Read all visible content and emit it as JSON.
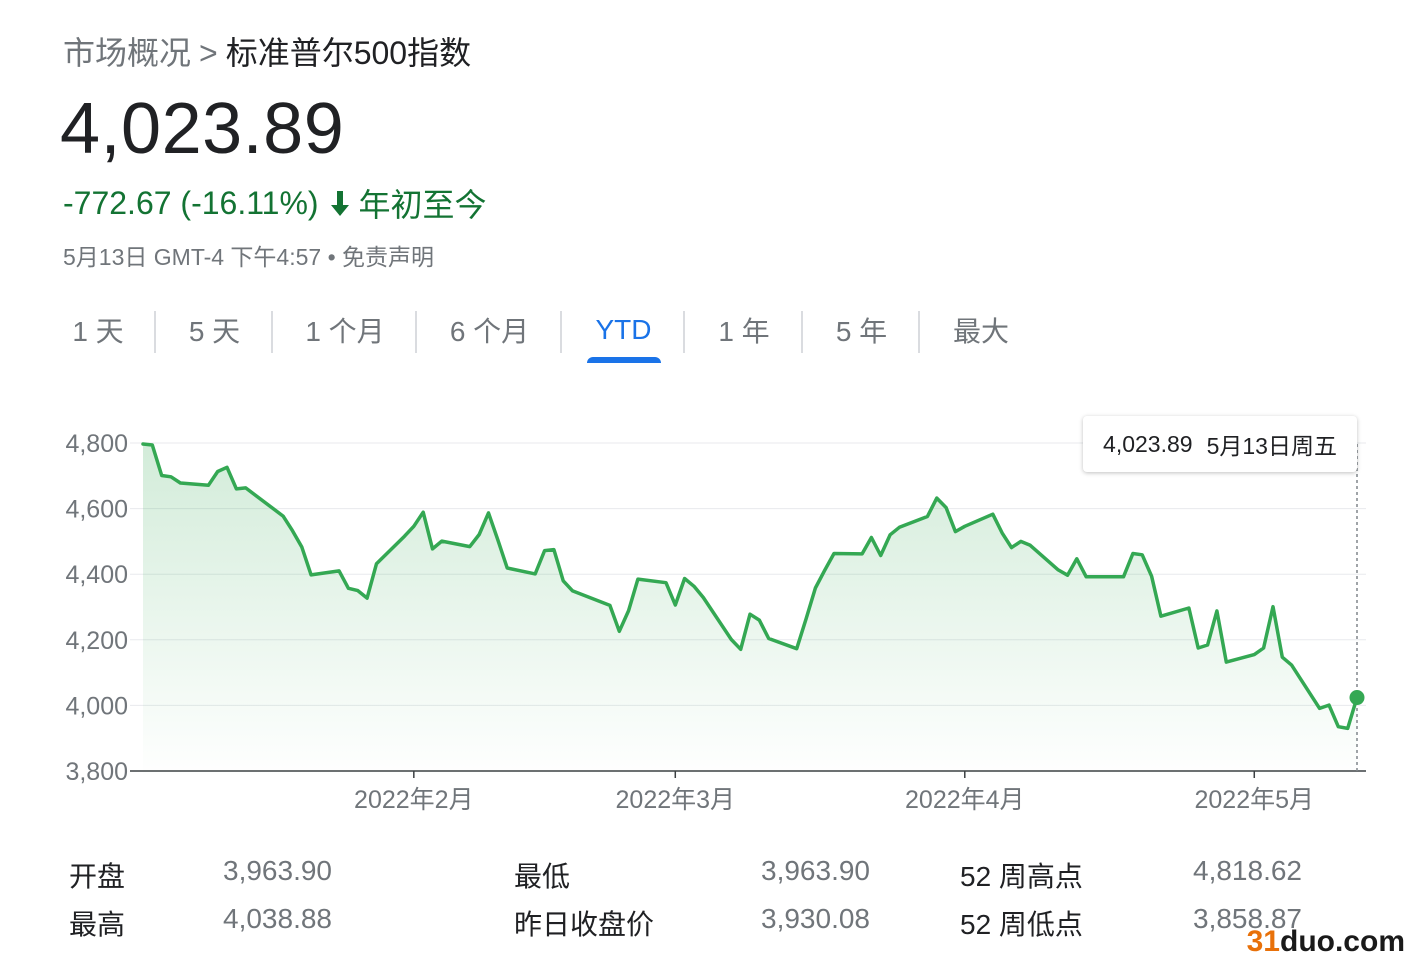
{
  "breadcrumb": {
    "parent": "市场概况",
    "separator": ">",
    "current": "标准普尔500指数"
  },
  "quote": {
    "price": "4,023.89",
    "change": "-772.67 (-16.11%)",
    "period": "年初至今",
    "timestamp": "5月13日 GMT-4 下午4:57",
    "bullet": "•",
    "disclaimer": "免责声明",
    "change_color": "#137333"
  },
  "tabs": [
    {
      "label": "1 天"
    },
    {
      "label": "5 天"
    },
    {
      "label": "1 个月"
    },
    {
      "label": "6 个月"
    },
    {
      "label": "YTD",
      "active": true
    },
    {
      "label": "1 年"
    },
    {
      "label": "5 年"
    },
    {
      "label": "最大"
    }
  ],
  "tooltip": {
    "value": "4,023.89",
    "date": "5月13日周五"
  },
  "chart_data": {
    "type": "area",
    "ylim": [
      3800,
      4800
    ],
    "yticks": [
      4800,
      4600,
      4400,
      4200,
      4000,
      3800
    ],
    "ytick_labels": [
      "4,800",
      "4,600",
      "4,400",
      "4,200",
      "4,000",
      "3,800"
    ],
    "xticks": [
      {
        "label": "2022年2月",
        "date": "2022-02-01"
      },
      {
        "label": "2022年3月",
        "date": "2022-03-01"
      },
      {
        "label": "2022年4月",
        "date": "2022-04-01"
      },
      {
        "label": "2022年5月",
        "date": "2022-05-02"
      }
    ],
    "grid": true,
    "line_color": "#34a853",
    "series": [
      {
        "points": [
          [
            "2022-01-03",
            4797
          ],
          [
            "2022-01-04",
            4794
          ],
          [
            "2022-01-05",
            4701
          ],
          [
            "2022-01-06",
            4697
          ],
          [
            "2022-01-07",
            4678
          ],
          [
            "2022-01-10",
            4671
          ],
          [
            "2022-01-11",
            4713
          ],
          [
            "2022-01-12",
            4726
          ],
          [
            "2022-01-13",
            4660
          ],
          [
            "2022-01-14",
            4663
          ],
          [
            "2022-01-18",
            4577
          ],
          [
            "2022-01-19",
            4533
          ],
          [
            "2022-01-20",
            4483
          ],
          [
            "2022-01-21",
            4398
          ],
          [
            "2022-01-24",
            4410
          ],
          [
            "2022-01-25",
            4357
          ],
          [
            "2022-01-26",
            4350
          ],
          [
            "2022-01-27",
            4327
          ],
          [
            "2022-01-28",
            4432
          ],
          [
            "2022-01-31",
            4516
          ],
          [
            "2022-02-01",
            4546
          ],
          [
            "2022-02-02",
            4589
          ],
          [
            "2022-02-03",
            4477
          ],
          [
            "2022-02-04",
            4501
          ],
          [
            "2022-02-07",
            4484
          ],
          [
            "2022-02-08",
            4521
          ],
          [
            "2022-02-09",
            4587
          ],
          [
            "2022-02-10",
            4504
          ],
          [
            "2022-02-11",
            4419
          ],
          [
            "2022-02-14",
            4401
          ],
          [
            "2022-02-15",
            4472
          ],
          [
            "2022-02-16",
            4475
          ],
          [
            "2022-02-17",
            4380
          ],
          [
            "2022-02-18",
            4349
          ],
          [
            "2022-02-22",
            4305
          ],
          [
            "2022-02-23",
            4226
          ],
          [
            "2022-02-24",
            4289
          ],
          [
            "2022-02-25",
            4385
          ],
          [
            "2022-02-28",
            4374
          ],
          [
            "2022-03-01",
            4306
          ],
          [
            "2022-03-02",
            4387
          ],
          [
            "2022-03-03",
            4363
          ],
          [
            "2022-03-04",
            4329
          ],
          [
            "2022-03-07",
            4201
          ],
          [
            "2022-03-08",
            4171
          ],
          [
            "2022-03-09",
            4278
          ],
          [
            "2022-03-10",
            4260
          ],
          [
            "2022-03-11",
            4204
          ],
          [
            "2022-03-14",
            4173
          ],
          [
            "2022-03-15",
            4263
          ],
          [
            "2022-03-16",
            4358
          ],
          [
            "2022-03-17",
            4412
          ],
          [
            "2022-03-18",
            4463
          ],
          [
            "2022-03-21",
            4462
          ],
          [
            "2022-03-22",
            4512
          ],
          [
            "2022-03-23",
            4457
          ],
          [
            "2022-03-24",
            4520
          ],
          [
            "2022-03-25",
            4543
          ],
          [
            "2022-03-28",
            4576
          ],
          [
            "2022-03-29",
            4632
          ],
          [
            "2022-03-30",
            4603
          ],
          [
            "2022-03-31",
            4530
          ],
          [
            "2022-04-01",
            4546
          ],
          [
            "2022-04-04",
            4583
          ],
          [
            "2022-04-05",
            4526
          ],
          [
            "2022-04-06",
            4481
          ],
          [
            "2022-04-07",
            4500
          ],
          [
            "2022-04-08",
            4488
          ],
          [
            "2022-04-11",
            4413
          ],
          [
            "2022-04-12",
            4397
          ],
          [
            "2022-04-13",
            4447
          ],
          [
            "2022-04-14",
            4392
          ],
          [
            "2022-04-18",
            4392
          ],
          [
            "2022-04-19",
            4463
          ],
          [
            "2022-04-20",
            4459
          ],
          [
            "2022-04-21",
            4394
          ],
          [
            "2022-04-22",
            4272
          ],
          [
            "2022-04-25",
            4297
          ],
          [
            "2022-04-26",
            4175
          ],
          [
            "2022-04-27",
            4184
          ],
          [
            "2022-04-28",
            4288
          ],
          [
            "2022-04-29",
            4132
          ],
          [
            "2022-05-02",
            4155
          ],
          [
            "2022-05-03",
            4175
          ],
          [
            "2022-05-04",
            4301
          ],
          [
            "2022-05-05",
            4147
          ],
          [
            "2022-05-06",
            4123
          ],
          [
            "2022-05-09",
            3991
          ],
          [
            "2022-05-10",
            4001
          ],
          [
            "2022-05-11",
            3935
          ],
          [
            "2022-05-12",
            3930
          ],
          [
            "2022-05-13",
            4024
          ]
        ]
      }
    ]
  },
  "stats": [
    {
      "label": "开盘",
      "value": "3,963.90"
    },
    {
      "label": "最低",
      "value": "3,963.90"
    },
    {
      "label": "52 周高点",
      "value": "4,818.62"
    },
    {
      "label": "最高",
      "value": "4,038.88"
    },
    {
      "label": "昨日收盘价",
      "value": "3,930.08"
    },
    {
      "label": "52 周低点",
      "value": "3,858.87"
    }
  ],
  "watermark": {
    "accent": "31",
    "rest": "duo.com"
  }
}
